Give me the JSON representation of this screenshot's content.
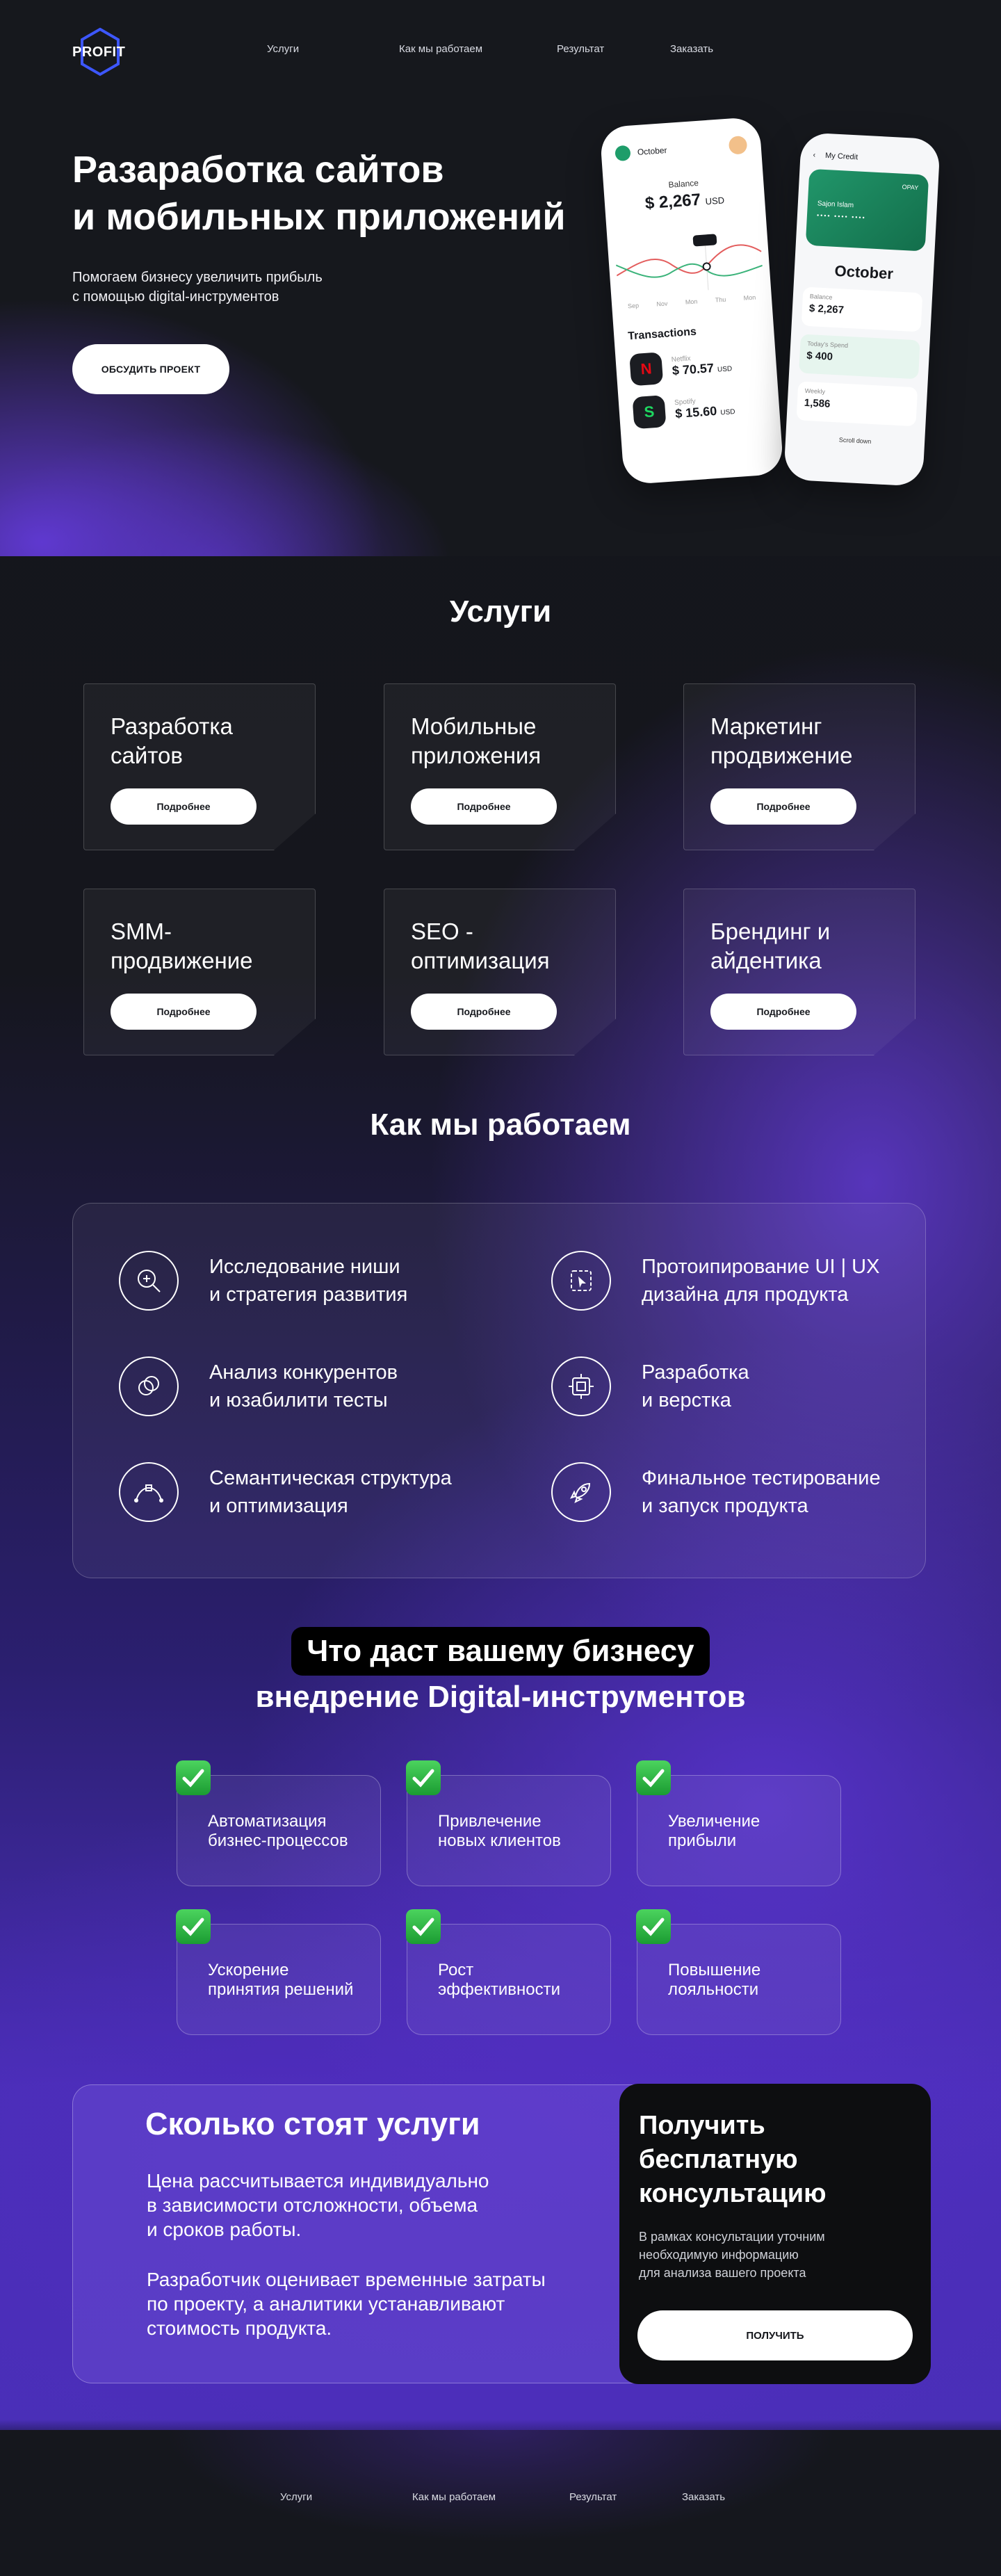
{
  "nav": {
    "logo": "PROFIT",
    "links": [
      "Услуги",
      "Как мы работаем",
      "Результат",
      "Заказать"
    ]
  },
  "hero": {
    "title_line1": "Разаработка сайтов",
    "title_line2": "и мобильных приложений",
    "subtitle_line1": "Помогаем бизнесу увеличить прибыль",
    "subtitle_line2": "с помощью digital-инструментов",
    "button": "ОБСУДИТЬ ПРОЕКТ",
    "phone1": {
      "month": "October",
      "balance_label": "Balance",
      "balance": "$ 2,267",
      "currency": "USD",
      "tooltip": "+900",
      "months": [
        "Sep",
        "Nov",
        "Mon",
        "Thu",
        "Mon"
      ],
      "transactions": "Transactions",
      "items": [
        {
          "name": "Netflix",
          "value": "$ 70.57",
          "cur": "USD",
          "icon": "N"
        },
        {
          "name": "Spotify",
          "value": "$ 15.60",
          "cur": "USD",
          "icon": "S"
        }
      ]
    },
    "phone2": {
      "title": "My Credit",
      "card_name": "Sajon Islam",
      "card_brand": "OPAY",
      "month": "October",
      "boxes": [
        {
          "label": "Balance",
          "value": "$ 2,267"
        },
        {
          "label": "Today's Spend",
          "value": "$ 400"
        },
        {
          "label": "Weekly",
          "value": "1,586"
        }
      ],
      "scroll": "Scroll down"
    }
  },
  "services": {
    "title": "Услуги",
    "button": "Подробнее",
    "items": [
      {
        "l1": "Разработка",
        "l2": "сайтов"
      },
      {
        "l1": "Мобильные",
        "l2": "приложения"
      },
      {
        "l1": "Маркетинг",
        "l2": "продвижение"
      },
      {
        "l1": "SMM-",
        "l2": "продвижение"
      },
      {
        "l1": "SEO -",
        "l2": "оптимизация"
      },
      {
        "l1": "Брендинг и",
        "l2": "айдентика"
      }
    ]
  },
  "how": {
    "title": "Как мы работаем",
    "items": [
      {
        "l1": "Исследование ниши",
        "l2": "и стратегия развития",
        "icon": "search-icon"
      },
      {
        "l1": "Протоипирование UI | UX",
        "l2": "дизайна для продукта",
        "icon": "prototype-icon"
      },
      {
        "l1": "Анализ конкурентов",
        "l2": "и юзабилити тесты",
        "icon": "analysis-icon"
      },
      {
        "l1": "Разработка",
        "l2": "и верстка",
        "icon": "development-icon"
      },
      {
        "l1": "Семантическая структура",
        "l2": "и оптимизация",
        "icon": "structure-icon"
      },
      {
        "l1": "Финальное тестирование",
        "l2": "и запуск продукта",
        "icon": "rocket-icon"
      }
    ]
  },
  "benefits": {
    "title_line1": "Что даст вашему бизнесу",
    "title_line2": "внедрение Digital-инструментов",
    "items": [
      {
        "l1": "Автоматизация",
        "l2": "бизнес-процессов"
      },
      {
        "l1": "Привлечение",
        "l2": "новых клиентов"
      },
      {
        "l1": "Увеличение",
        "l2": "прибыли"
      },
      {
        "l1": "Ускорение",
        "l2": "принятия решений"
      },
      {
        "l1": "Рост",
        "l2": "эффективности"
      },
      {
        "l1": "Повышение",
        "l2": "лояльности"
      }
    ]
  },
  "price": {
    "title": "Сколько стоят услуги",
    "p1": [
      "Цена рассчитывается индивидуально",
      "в зависимости отсложности, объема",
      "и сроков работы."
    ],
    "p2": [
      "Разработчик оценивает временные затраты",
      "по проекту, а аналитики устанавливают",
      "стоимость продукта."
    ]
  },
  "consult": {
    "title": [
      "Получить",
      "бесплатную",
      "консультацию"
    ],
    "text": [
      "В рамках консультации уточним",
      "необходимую информацию",
      "для анализа вашего проекта"
    ],
    "button": "ПОЛУЧИТЬ"
  },
  "footer": {
    "links": [
      "Услуги",
      "Как мы работаем",
      "Результат",
      "Заказать"
    ]
  }
}
